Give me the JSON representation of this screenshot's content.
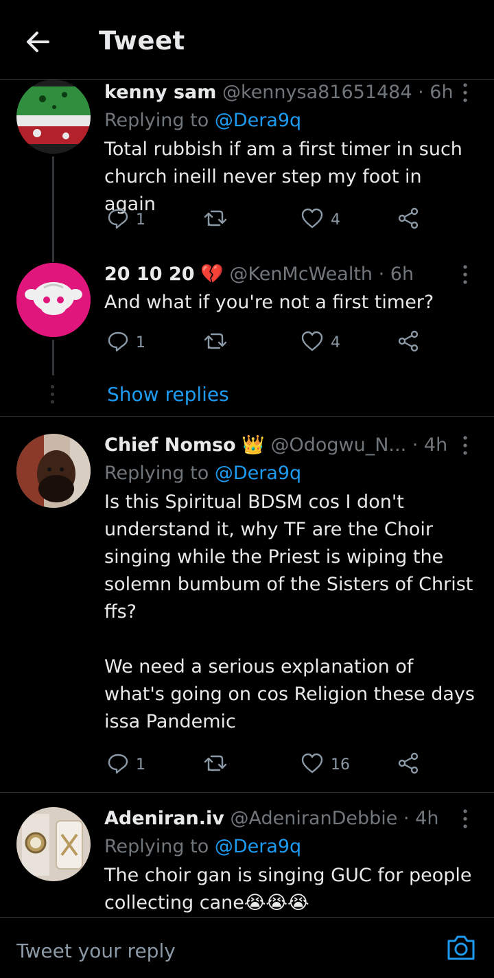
{
  "header": {
    "title": "Tweet"
  },
  "tweets": [
    {
      "name": "kenny sam",
      "handle": "@kennysa81651484",
      "time": "· 6h",
      "replying_prefix": "Replying to ",
      "replying_to": "@Dera9q",
      "text": "Total rubbish if am a first timer in such church ineill never step my foot in again",
      "replies": "1",
      "retweets": "",
      "likes": "4"
    },
    {
      "name": "20 10 20",
      "emoji": "💔",
      "handle": "@KenMcWealth",
      "time": "· 6h",
      "text": "And what if you're not a first timer?",
      "replies": "1",
      "retweets": "",
      "likes": "4"
    },
    {
      "name": "Chief Nomso",
      "emoji": "👑",
      "handle": "@Odogwu_N...",
      "time": "· 4h",
      "replying_prefix": "Replying to ",
      "replying_to": "@Dera9q",
      "text": "Is this Spiritual BDSM cos I don't understand it, why TF are the Choir singing while the Priest is wiping the solemn bumbum of the Sisters of Christ ffs?\n\nWe need a serious explanation of what's going on cos Religion these days issa Pandemic",
      "replies": "1",
      "retweets": "",
      "likes": "16"
    },
    {
      "name": "Adeniran.iv",
      "handle": "@AdeniranDebbie",
      "time": "· 4h",
      "replying_prefix": "Replying to ",
      "replying_to": "@Dera9q",
      "text": "The choir gan is singing GUC for people collecting cane😭😭😭"
    }
  ],
  "show_replies": "Show replies",
  "composer": {
    "placeholder": "Tweet your reply"
  },
  "colors": {
    "accent": "#1d9bf0",
    "background": "#000000",
    "secondary_text": "#71767b",
    "divider": "#2f3336"
  },
  "icons": [
    "back-arrow-icon",
    "more-icon",
    "reply-icon",
    "retweet-icon",
    "like-icon",
    "share-icon",
    "camera-icon"
  ]
}
